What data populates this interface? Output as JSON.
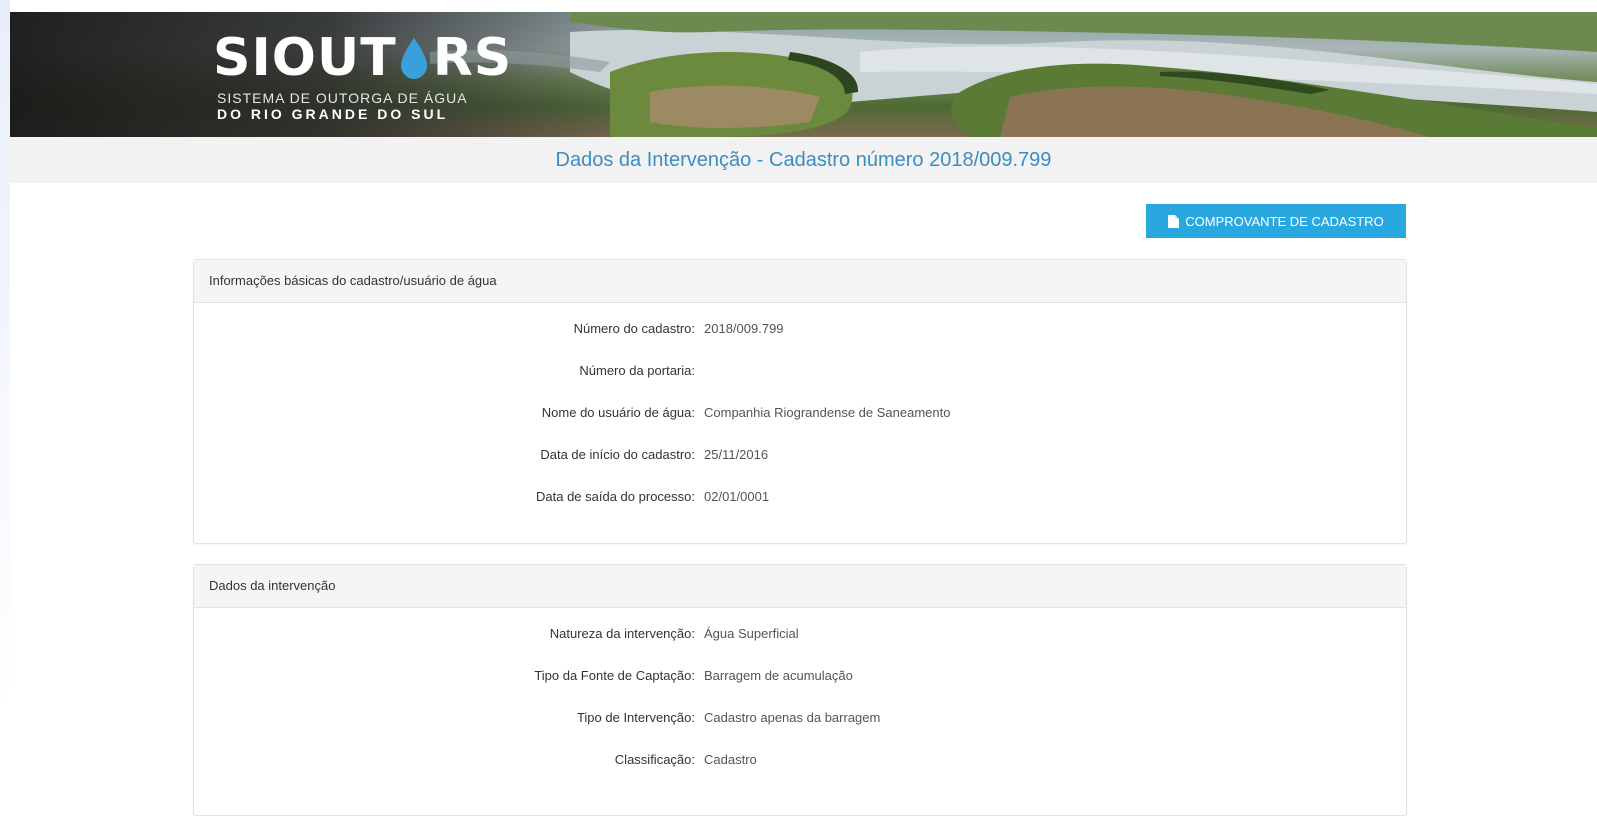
{
  "banner": {
    "logo_title_left": "SIOUT",
    "logo_title_right": "RS",
    "logo_subtitle_1": "SISTEMA DE OUTORGA DE ÁGUA",
    "logo_subtitle_2": "DO RIO GRANDE DO SUL"
  },
  "page_title": "Dados da Intervenção - Cadastro número 2018/009.799",
  "actions": {
    "receipt_label": "COMPROVANTE DE CADASTRO",
    "receipt_icon": "file-icon"
  },
  "basic_info": {
    "heading": "Informações básicas do cadastro/usuário de água",
    "fields": [
      {
        "label": "Número do cadastro:",
        "value": "2018/009.799"
      },
      {
        "label": "Número da portaria:",
        "value": ""
      },
      {
        "label": "Nome do usuário de água:",
        "value": "Companhia Riograndense de Saneamento"
      },
      {
        "label": "Data de início do cadastro:",
        "value": "25/11/2016"
      },
      {
        "label": "Data de saída do processo:",
        "value": "02/01/0001"
      }
    ]
  },
  "intervention": {
    "heading": "Dados da intervenção",
    "fields": [
      {
        "label": "Natureza da intervenção:",
        "value": "Água Superficial"
      },
      {
        "label": "Tipo da Fonte de Captação:",
        "value": "Barragem de acumulação"
      },
      {
        "label": "Tipo de Intervenção:",
        "value": "Cadastro apenas da barragem"
      },
      {
        "label": "Classificação:",
        "value": "Cadastro"
      }
    ]
  },
  "colors": {
    "accent": "#29a8e0",
    "title_text": "#3b8ec2",
    "logo_drop": "#3aa0dc"
  }
}
